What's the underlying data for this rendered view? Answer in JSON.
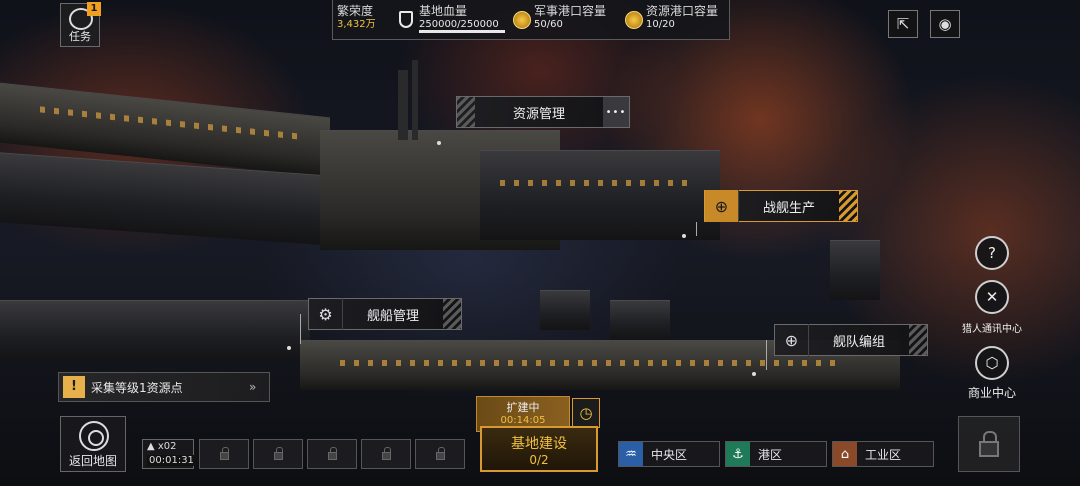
{
  "top_bar": {
    "prosperity_label": "繁荣度",
    "prosperity_value": "3,432万",
    "base_hp_label": "基地血量",
    "base_hp_value": "250000/250000",
    "base_hp_fraction": 1.0,
    "military_port_label": "军事港口容量",
    "military_port_value": "50/60",
    "resource_port_label": "资源港口容量",
    "resource_port_value": "10/20"
  },
  "mission": {
    "label": "任务",
    "badge": "1"
  },
  "top_right": {
    "share_icon": "share-icon",
    "view_icon": "eye-icon"
  },
  "facilities": {
    "resource_management": "资源管理",
    "warship_production": "战舰生产",
    "ship_management": "舰船管理",
    "fleet_formation": "舰队编组"
  },
  "side_buttons": {
    "help_icon": "?",
    "hunter_comm": "猎人通讯中心",
    "commerce": "商业中心"
  },
  "quest": {
    "icon": "!",
    "text": "采集等级1资源点",
    "arrow": "»"
  },
  "bottom": {
    "back_map": "返回地图",
    "queue_count": "▲ x02",
    "queue_timer": "00:01:31",
    "expanding_label": "扩建中",
    "expanding_timer": "00:14:05",
    "base_build_label": "基地建设",
    "base_build_count": "0/2",
    "districts": [
      "中央区",
      "港区",
      "工业区"
    ]
  },
  "colors": {
    "accent_gold": "#d89a30",
    "gold_text": "#f0c040",
    "central_icon": "#2a5fa8",
    "port_icon": "#1f7a5a",
    "industrial_icon": "#8a4a2a"
  }
}
